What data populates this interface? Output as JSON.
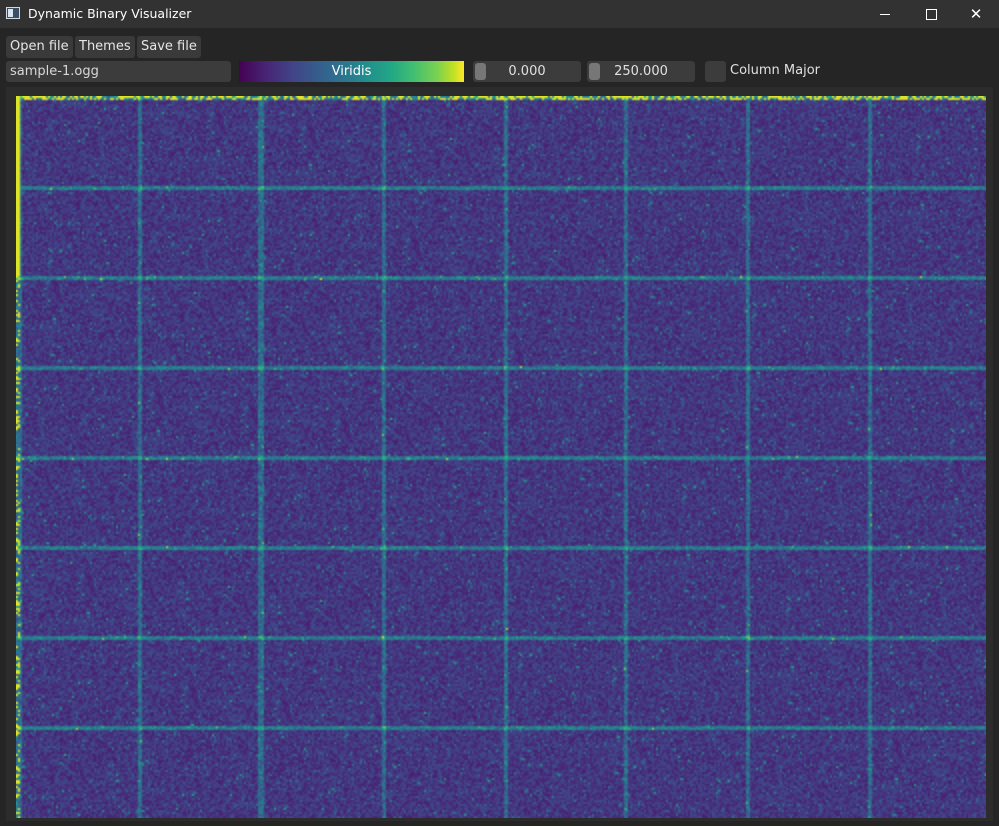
{
  "window": {
    "title": "Dynamic Binary Visualizer",
    "icon": "app-window-icon",
    "controls": [
      "minimize-icon",
      "maximize-icon",
      "close-icon"
    ],
    "close_glyph": "✕"
  },
  "toolbar": {
    "open_label": "Open file",
    "themes_label": "Themes",
    "save_label": "Save file"
  },
  "controls": {
    "filename": "sample-1.ogg",
    "colormap": "Viridis",
    "range_min": "0.000",
    "range_max": "250.000",
    "column_major_label": "Column Major",
    "column_major_checked": false
  },
  "visualization": {
    "description_colors": [
      "#440154",
      "#482878",
      "#3e4989",
      "#31688e",
      "#26828e",
      "#1f9e89",
      "#35b779",
      "#6ece58",
      "#b5de2b",
      "#fde725"
    ],
    "background": "#413b7e"
  }
}
